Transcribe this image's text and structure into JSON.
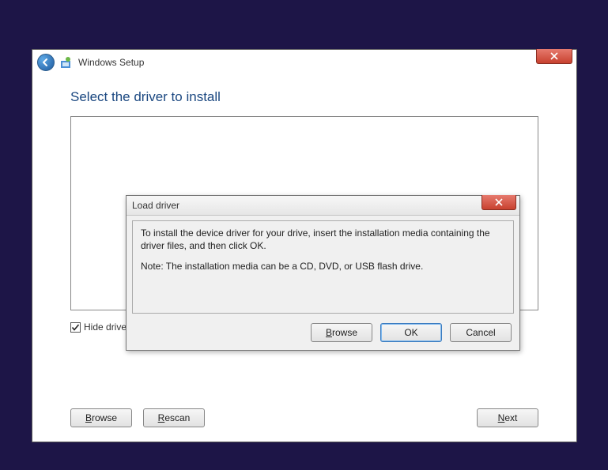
{
  "main": {
    "appTitle": "Windows Setup",
    "heading": "Select the driver to install",
    "hideIncompatibleLabel": "Hide drivers that aren't compatible with this computer's hardware.",
    "hideIncompatibleChecked": true,
    "buttons": {
      "browse": "Browse",
      "rescan": "Rescan",
      "next": "Next"
    }
  },
  "dialog": {
    "title": "Load driver",
    "message1": "To install the device driver for your drive, insert the installation media containing the driver files, and then click OK.",
    "message2": "Note: The installation media can be a CD, DVD, or USB flash drive.",
    "buttons": {
      "browse": "Browse",
      "ok": "OK",
      "cancel": "Cancel"
    }
  }
}
